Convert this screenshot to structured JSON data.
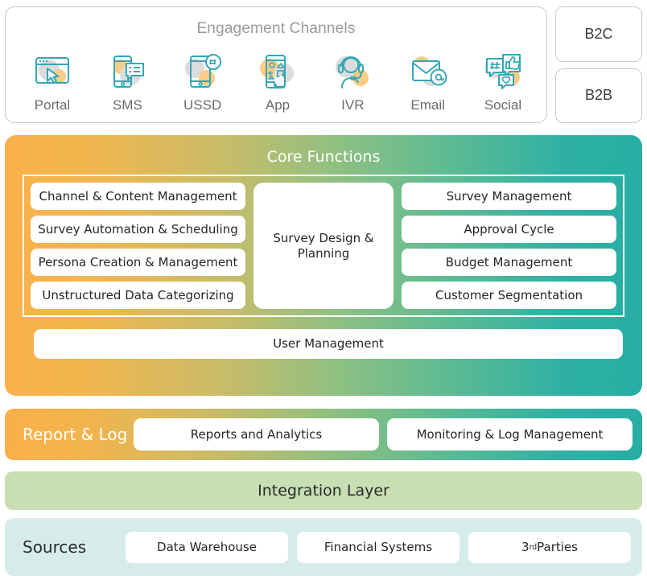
{
  "engagement": {
    "title": "Engagement Channels",
    "channels": [
      {
        "label": "Portal",
        "icon": "browser-window-cursor-icon"
      },
      {
        "label": "SMS",
        "icon": "mobile-chat-bubble-icon"
      },
      {
        "label": "USSD",
        "icon": "mobile-hash-icon"
      },
      {
        "label": "App",
        "icon": "mobile-app-tap-icon"
      },
      {
        "label": "IVR",
        "icon": "headset-agent-icon"
      },
      {
        "label": "Email",
        "icon": "envelope-at-icon"
      },
      {
        "label": "Social",
        "icon": "hashtag-thumbsup-icon"
      }
    ]
  },
  "segments": [
    {
      "label": "B2C"
    },
    {
      "label": "B2B"
    }
  ],
  "core": {
    "title": "Core Functions",
    "left_column": [
      "Channel & Content Management",
      "Survey Automation & Scheduling",
      "Persona Creation & Management",
      "Unstructured Data Categorizing"
    ],
    "center": "Survey Design & Planning",
    "right_column": [
      "Survey Management",
      "Approval Cycle",
      "Budget Management",
      "Customer Segmentation"
    ],
    "footer": "User Management"
  },
  "report": {
    "label": "Report & Log",
    "cards": [
      "Reports and Analytics",
      "Monitoring & Log Management"
    ]
  },
  "integration": {
    "label": "Integration Layer"
  },
  "sources": {
    "label": "Sources",
    "cards": [
      {
        "text": "Data Warehouse",
        "html": false
      },
      {
        "text": "Financial Systems",
        "html": false
      },
      {
        "text": "3<sup>rd</sup> Parties",
        "html": true
      }
    ]
  },
  "colors": {
    "gradient_start": "#fbb04a",
    "gradient_end": "#27aea4",
    "integration_bg": "#c8dfb4",
    "sources_bg": "#d6ecea",
    "icon_teal": "#34a6b5",
    "icon_orange": "#fbcc88",
    "icon_gray": "#dcdcdc",
    "panel_border": "#c9c9c9",
    "title_gray": "#9a9a9a"
  }
}
